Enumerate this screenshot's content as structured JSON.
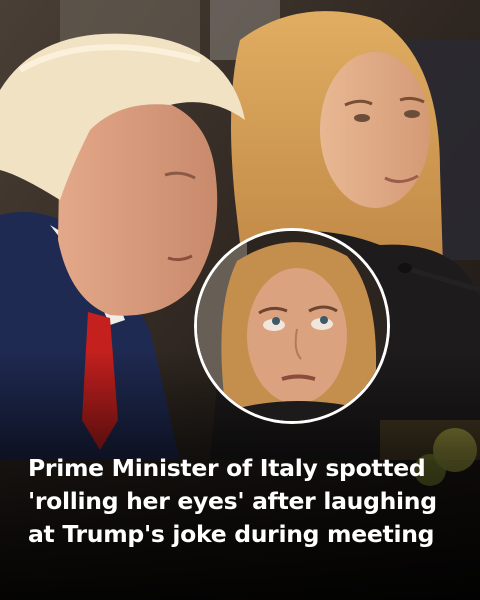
{
  "headline": {
    "lines": [
      "Prime Minister of Italy spotted",
      "'rolling her eyes' after laughing",
      "at Trump's joke during meeting"
    ]
  },
  "colors": {
    "headline_text": "#ffffff",
    "inset_border": "#ffffff",
    "tie": "#c4201e",
    "suit": "#1f2a52",
    "hair_blonde": "#d9a55c"
  }
}
